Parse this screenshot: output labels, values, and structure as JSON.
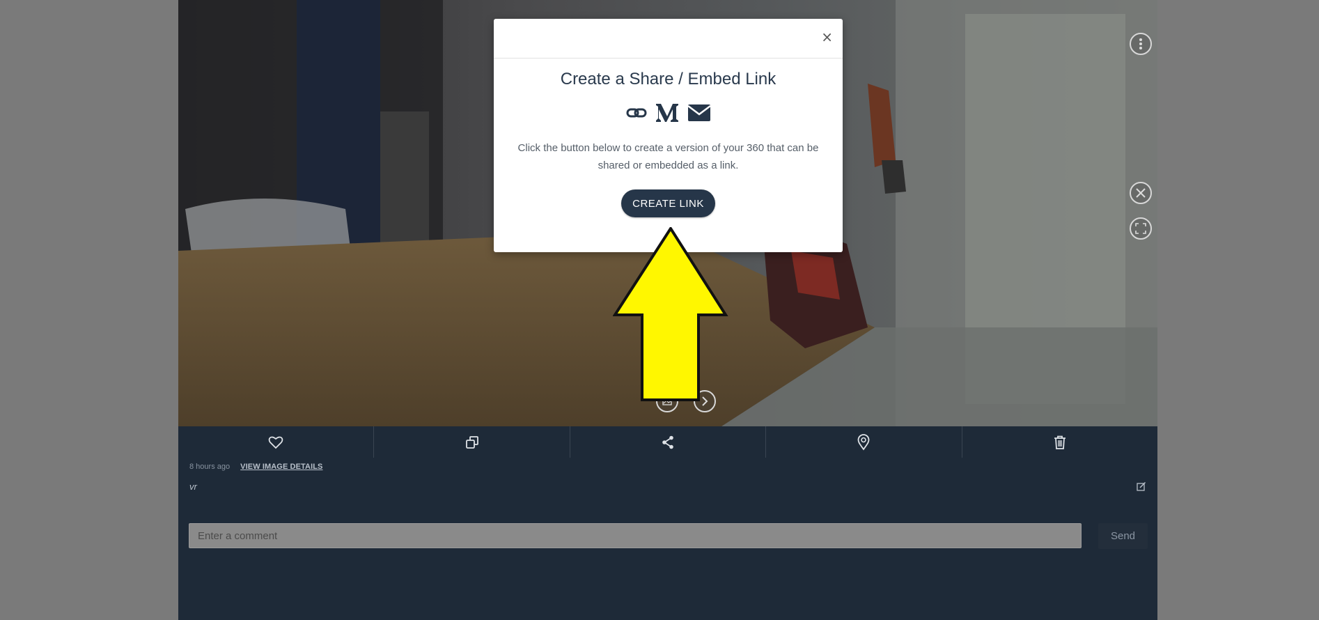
{
  "viewer": {
    "menu_icon": "vertical-dots-icon",
    "close_icon": "circle-x-icon",
    "fullscreen_icon": "fullscreen-icon",
    "gallery_icon": "image-icon",
    "next_icon": "chevron-right-icon"
  },
  "toolbar": {
    "items": [
      {
        "icon": "heart-icon"
      },
      {
        "icon": "copy-icon"
      },
      {
        "icon": "share-icon"
      },
      {
        "icon": "map-pin-icon"
      },
      {
        "icon": "trash-icon"
      }
    ]
  },
  "info": {
    "timestamp": "8 hours ago",
    "details_link": "VIEW IMAGE DETAILS",
    "caption": "vr",
    "comment_placeholder": "Enter a comment",
    "comment_value": "",
    "send_label": "Send"
  },
  "modal": {
    "close_label": "×",
    "title": "Create a Share / Embed Link",
    "icons": [
      "link-icon",
      "medium-icon",
      "envelope-icon"
    ],
    "description": "Click the button below to create a version of your 360 that can be shared or embedded as a link.",
    "button_label": "CREATE LINK"
  },
  "annotation": {
    "arrow_color": "#fff700"
  }
}
